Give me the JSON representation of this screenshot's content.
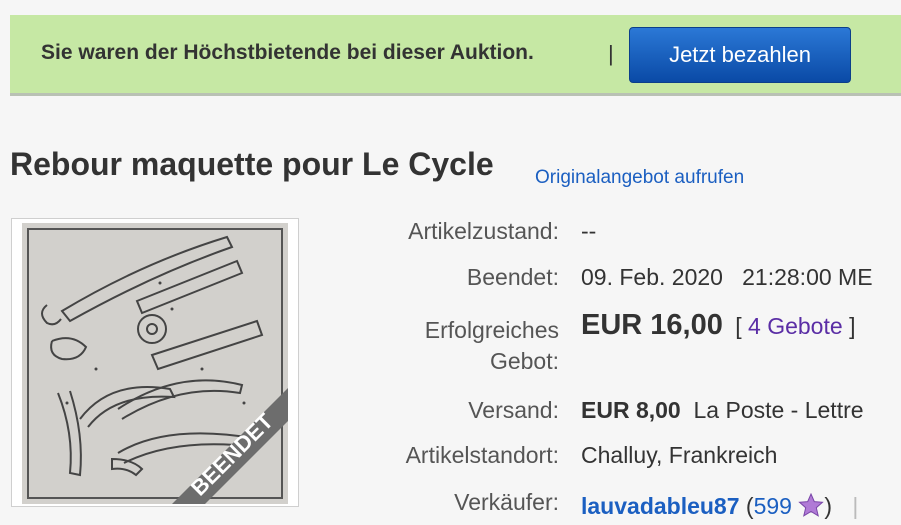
{
  "banner": {
    "message": "Sie waren der Höchstbietende bei dieser Auktion.",
    "separator": "|",
    "pay_label": "Jetzt bezahlen"
  },
  "listing": {
    "title": "Rebour maquette pour Le Cycle",
    "original_link": "Originalangebot aufrufen",
    "image_ribbon": "BEENDET"
  },
  "details": {
    "condition_label": "Artikelzustand:",
    "condition_value": "--",
    "ended_label": "Beendet:",
    "ended_date": "09. Feb. 2020",
    "ended_time": "21:28:00 ME",
    "bid_label_line1": "Erfolgreiches",
    "bid_label_line2": "Gebot:",
    "winning_price": "EUR 16,00",
    "bids_open": "[",
    "bids_count": "4 Gebote",
    "bids_close": "]",
    "shipping_label": "Versand:",
    "shipping_amount": "EUR 8,00",
    "shipping_method": "La Poste - Lettre",
    "location_label": "Artikelstandort:",
    "location_value": "Challuy, Frankreich",
    "seller_label": "Verkäufer:",
    "seller_name": "lauvadableu87",
    "feedback_open": "(",
    "feedback_score": "599",
    "feedback_close": ")",
    "trailing_sep": "|"
  },
  "colors": {
    "banner_bg": "#c6e8a4",
    "button_bg": "#0a4aa6",
    "link": "#1b5fc1",
    "bids_link": "#5a2da5",
    "star": "#b07ad6"
  }
}
